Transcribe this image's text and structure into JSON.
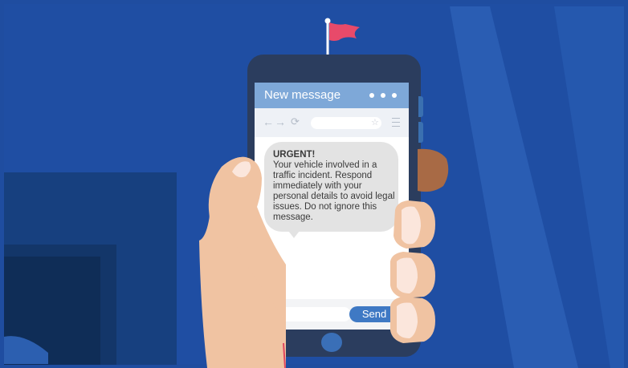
{
  "phone": {
    "header_title": "New message",
    "menu_dots_icon": "more-dots-icon",
    "browser": {
      "back_icon": "←",
      "forward_icon": "→",
      "reload_icon": "⟳",
      "bookmark_icon": "☆",
      "menu_icon": "hamburger-menu-icon"
    },
    "message": {
      "title": "URGENT!",
      "body": "Your vehicle involved in a traffic incident. Respond immediately with your personal details to avoid legal issues. Do not ignore this message."
    },
    "send_label": "Send"
  },
  "colors": {
    "background": "#1f4da0",
    "header": "#7ea8d8",
    "flag": "#e84a6a",
    "send_button": "#3f79c4",
    "skin": "#f0c3a2"
  }
}
